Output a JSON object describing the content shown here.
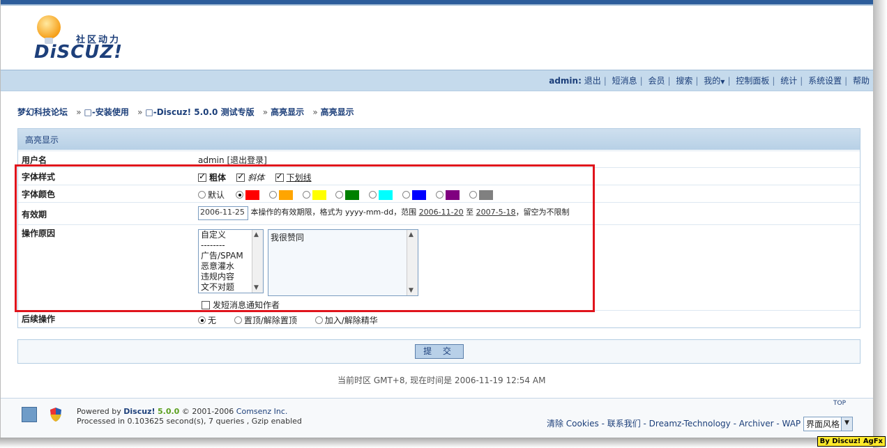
{
  "logo": {
    "sub": "社区动力",
    "main": "DiSCUZ!"
  },
  "nav": {
    "user": "admin:",
    "items": [
      "退出",
      "短消息",
      "会员",
      "搜索",
      "我的",
      "控制面板",
      "统计",
      "系统设置",
      "帮助"
    ]
  },
  "breadcrumb": [
    "梦幻科技论坛",
    "□-安装使用",
    "□-Discuz! 5.0.0 测试专版",
    "高亮显示",
    "高亮显示"
  ],
  "panel": {
    "title": "高亮显示",
    "username": {
      "label": "用户名",
      "value": "admin",
      "logout": "[退出登录]"
    },
    "font_style": {
      "label": "字体样式",
      "bold": "粗体",
      "italic": "斜体",
      "underline": "下划线"
    },
    "font_color": {
      "label": "字体颜色",
      "default": "默认",
      "colors": [
        "#ff0000",
        "#ffa500",
        "#ffff00",
        "#008000",
        "#00ffff",
        "#0000ff",
        "#800080",
        "#808080"
      ]
    },
    "validity": {
      "label": "有效期",
      "value": "2006-11-25",
      "desc1": "本操作的有效期限，格式为",
      "format": "yyyy-mm-dd",
      "desc2": "，范围",
      "from": "2006-11-20",
      "to_word": "至",
      "to": "2007-5-18",
      "desc3": "，留空为不限制"
    },
    "reason": {
      "label": "操作原因",
      "options": [
        "自定义",
        "--------",
        "广告/SPAM",
        "恶意灌水",
        "违规内容",
        "文不对题"
      ],
      "text": "我很赞同",
      "notify": "发短消息通知作者"
    },
    "followup": {
      "label": "后续操作",
      "options": [
        "无",
        "置顶/解除置顶",
        "加入/解除精华"
      ]
    }
  },
  "submit_label": "提 交",
  "timezone": "当前时区  GMT+8, 现在时间是  2006-11-19 12:54 AM",
  "footer": {
    "powered_prefix": "Powered by",
    "brand": "Discuz!",
    "version": "5.0.0",
    "copyright": "© 2001-2006",
    "company": "Comsenz Inc.",
    "processed": "Processed in 0.103625 second(s), 7 queries , Gzip enabled",
    "links": "清除  Cookies - 联系我们  - Dreamz-Technology - Archiver - WAP",
    "style_select": "界面风格",
    "top": "TOP"
  },
  "badge": "By Discuz! AgFx"
}
